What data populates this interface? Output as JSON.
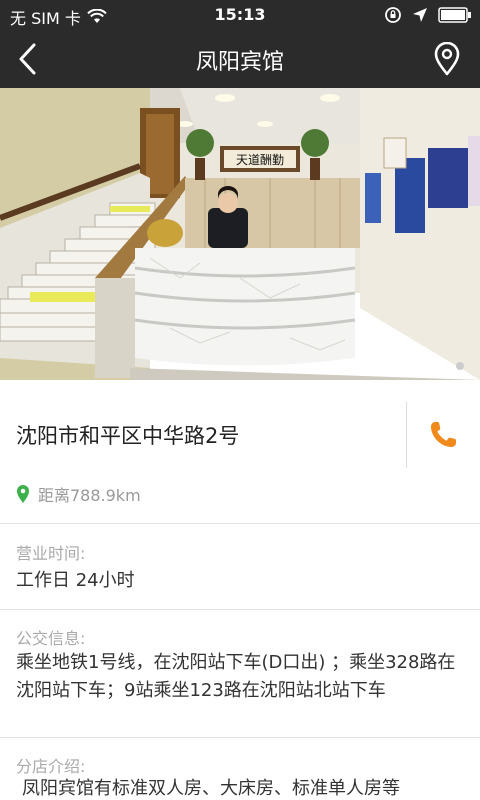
{
  "status_bar": {
    "carrier": "无 SIM 卡",
    "time": "15:13"
  },
  "nav": {
    "title": "凤阳宾馆",
    "back_icon": "chevron-left-icon",
    "location_icon": "map-pin-icon"
  },
  "hotel": {
    "address": "沈阳市和平区中华路2号",
    "distance": "距离788.9km",
    "phone_icon": "phone-icon",
    "accent_color": "#f08a1c",
    "pin_color": "#3cb04a"
  },
  "sections": {
    "hours_label": "营业时间:",
    "hours_value": "工作日 24小时",
    "transit_label": "公交信息:",
    "transit_value": "乘坐地铁1号线，在沈阳站下车(D口出) ；乘坐328路在沈阳站下车；9站乘坐123路在沈阳站北站下车",
    "branch_label": "分店介绍:",
    "branch_value": "凤阳宾馆有标准双人房、大床房、标准单人房等"
  },
  "photo": {
    "sign_text": "天道酬勤"
  }
}
